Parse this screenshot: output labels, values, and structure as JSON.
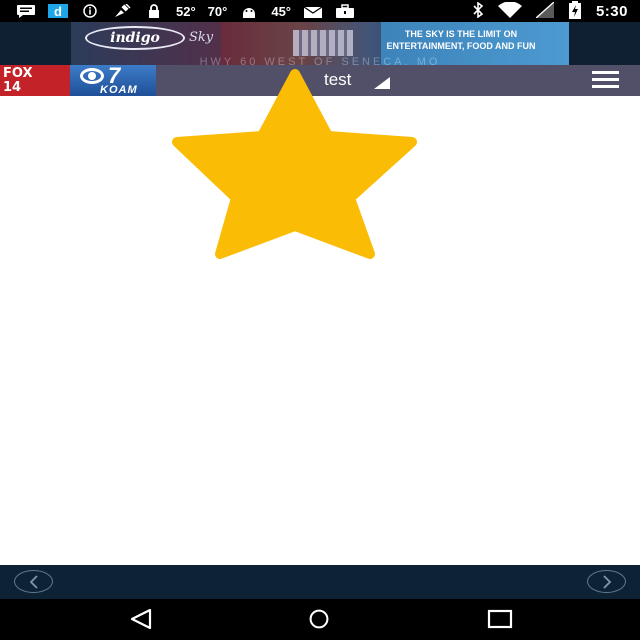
{
  "status_bar": {
    "icons": [
      "message-icon",
      "app-d-icon",
      "info-icon",
      "satellite-icon",
      "lock-icon",
      "android-icon",
      "mail-icon",
      "briefcase-icon"
    ],
    "temps": [
      "52°",
      "70°",
      "45°"
    ],
    "right_icons": [
      "bluetooth-icon",
      "wifi-icon",
      "signal-icon",
      "battery-charging-icon"
    ],
    "time": "5:30"
  },
  "ad": {
    "brand": "indigo",
    "brand_tail": "Sky",
    "headline_line1": "THE SKY IS THE LIMIT ON",
    "headline_line2": "ENTERTAINMENT, FOOD AND FUN",
    "address": "HWY 60 WEST OF SENECA, MO"
  },
  "header": {
    "logo_fox": "FOX",
    "logo_fox_num": "14",
    "logo_cbs_num": "7",
    "logo_koam": "KOAM",
    "title": "test"
  },
  "colors": {
    "header_bg": "#525068",
    "star": "#fbbc05",
    "bottom_nav_bg": "#0e2236"
  }
}
